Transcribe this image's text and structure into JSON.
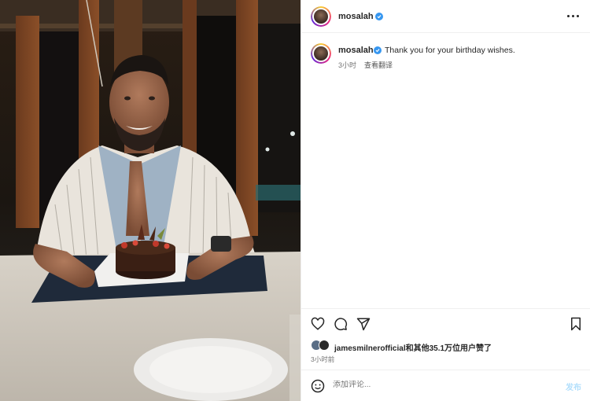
{
  "post": {
    "username": "mosalah",
    "caption": "Thank you for your birthday wishes.",
    "caption_time": "3小时",
    "see_translation": "查看翻译",
    "liked_by_user": "jamesmilnerofficial",
    "liked_by_rest": "和其他35.1万位用户赞了",
    "post_time": "3小时前"
  },
  "comment": {
    "placeholder": "添加评论...",
    "post_label": "发布"
  },
  "colors": {
    "verified": "#3797f0",
    "post_disabled": "#b2dffc",
    "divider": "#efefef"
  },
  "icons": {
    "header_more": "more-horizontal-icon",
    "like": "heart-icon",
    "comment": "comment-icon",
    "share": "send-icon",
    "save": "bookmark-icon",
    "emoji": "emoji-icon"
  }
}
